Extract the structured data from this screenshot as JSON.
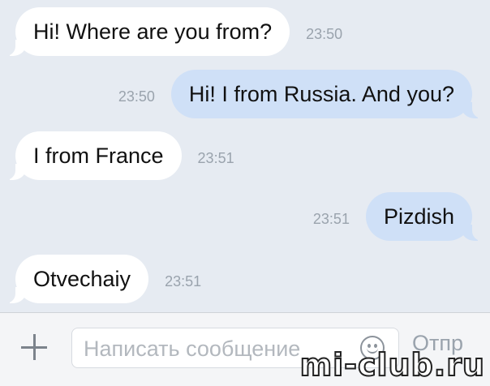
{
  "messages": [
    {
      "direction": "in",
      "text": "Hi! Where are you from?",
      "time": "23:50"
    },
    {
      "direction": "out",
      "text": "Hi! I from Russia. And you?",
      "time": "23:50"
    },
    {
      "direction": "in",
      "text": "I from France",
      "time": "23:51"
    },
    {
      "direction": "out",
      "text": "Pizdish",
      "time": "23:51"
    },
    {
      "direction": "in",
      "text": "Otvechaiy",
      "time": "23:51"
    }
  ],
  "input_bar": {
    "attach_icon": "plus-icon",
    "placeholder": "Написать сообщение",
    "emoji_icon": "smiley-icon",
    "send_label": "Отпр"
  },
  "watermark": "mi-club.ru",
  "colors": {
    "background": "#e6ebf2",
    "incoming_bubble": "#ffffff",
    "outgoing_bubble": "#cfe0f7",
    "time_text": "#9aa3ad"
  }
}
